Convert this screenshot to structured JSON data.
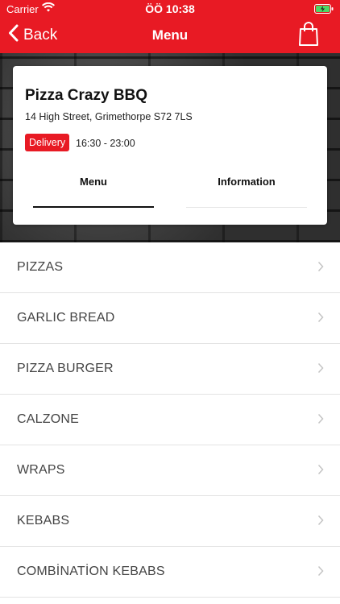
{
  "status_bar": {
    "carrier": "Carrier",
    "time": "ÖÖ 10:38"
  },
  "nav": {
    "back_label": "Back",
    "title": "Menu"
  },
  "restaurant": {
    "name": "Pizza Crazy BBQ",
    "address": "14 High Street, Grimethorpe S72 7LS",
    "badge": "Delivery",
    "hours": "16:30 - 23:00"
  },
  "tabs": [
    {
      "label": "Menu",
      "active": true
    },
    {
      "label": "Information",
      "active": false
    }
  ],
  "categories": [
    {
      "label": "PIZZAS"
    },
    {
      "label": "GARLIC BREAD"
    },
    {
      "label": "PIZZA BURGER"
    },
    {
      "label": "CALZONE"
    },
    {
      "label": "WRAPS"
    },
    {
      "label": "KEBABS"
    },
    {
      "label": "COMBİNATİON KEBABS"
    }
  ],
  "colors": {
    "brand": "#e81a24"
  }
}
